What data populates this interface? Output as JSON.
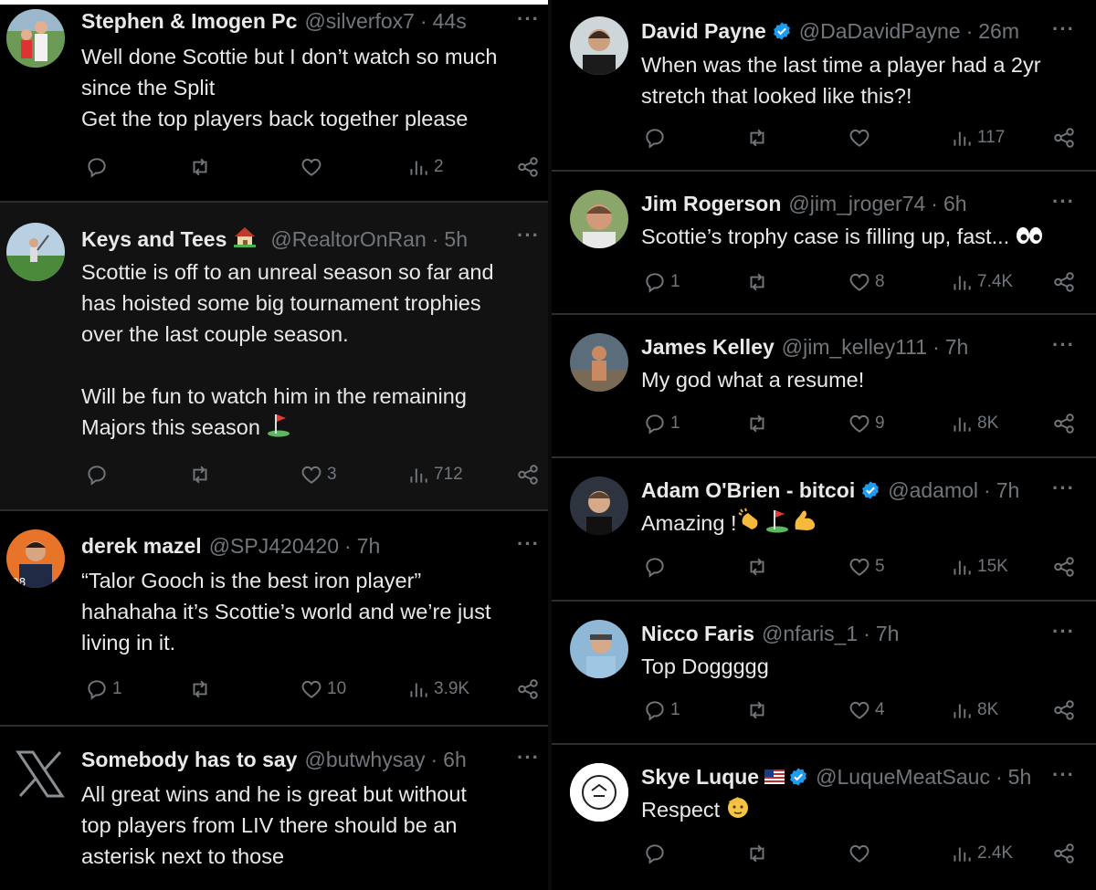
{
  "left_tweets": [
    {
      "name": "Stephen & Imogen Pc",
      "handle": "@silverfox7",
      "time": "44s",
      "text": "Well done Scottie but I don’t watch so much\nsince the Split\nGet the top players back together please",
      "replies": "",
      "likes": "",
      "views": "2"
    },
    {
      "name": "Keys and Tees",
      "handle": "@RealtorOnRan",
      "time": "5h",
      "text": "Scottie is off to an unreal season so far and\nhas hoisted some big tournament trophies\nover the last couple season.\n\nWill be fun to watch him in the remaining\nMajors this season",
      "replies": "",
      "likes": "3",
      "views": "712"
    },
    {
      "name": "derek mazel",
      "handle": "@SPJ420420",
      "time": "7h",
      "text": "“Talor Gooch is the best iron player”\nhahahaha it’s Scottie’s world and we’re just\nliving in it.",
      "replies": "1",
      "likes": "10",
      "views": "3.9K"
    },
    {
      "name": "Somebody has to say",
      "handle": "@butwhysay",
      "time": "6h",
      "text": "All great wins and he is great but without\ntop players from LIV there should be an\nasterisk next to those",
      "replies": "",
      "likes": "",
      "views": ""
    }
  ],
  "right_tweets": [
    {
      "name": "David Payne",
      "handle": "@DaDavidPayne",
      "time": "26m",
      "text": "When was the last time a player had a 2yr\nstretch that looked like this?!",
      "replies": "",
      "likes": "",
      "views": "117"
    },
    {
      "name": "Jim Rogerson",
      "handle": "@jim_jroger74",
      "time": "6h",
      "text": "Scottie’s trophy case is filling up, fast...",
      "replies": "1",
      "likes": "8",
      "views": "7.4K"
    },
    {
      "name": "James Kelley",
      "handle": "@jim_kelley111",
      "time": "7h",
      "text": "My god what a resume!",
      "replies": "1",
      "likes": "9",
      "views": "8K"
    },
    {
      "name": "Adam O'Brien - bitcoi",
      "handle": "@adamol",
      "time": "7h",
      "text": "Amazing !",
      "replies": "",
      "likes": "5",
      "views": "15K"
    },
    {
      "name": "Nicco Faris",
      "handle": "@nfaris_1",
      "time": "7h",
      "text": "Top Doggggg",
      "replies": "1",
      "likes": "4",
      "views": "8K"
    },
    {
      "name": "Skye Luque",
      "handle": "@LuqueMeatSauc",
      "time": "5h",
      "text": "Respect",
      "replies": "",
      "likes": "",
      "views": "2.4K"
    }
  ],
  "ui": {
    "more_label": "···",
    "dot": "·"
  },
  "icons": {
    "reply": "reply-icon",
    "repost": "repost-icon",
    "like": "like-icon",
    "views": "views-icon",
    "share": "share-icon",
    "verified": "verified-badge-icon"
  },
  "colors": {
    "background": "#000000",
    "dim_background": "#121212",
    "text": "#e7e9ea",
    "muted": "#71767b",
    "verified": "#1d9bf0",
    "divider": "#2a2f33"
  }
}
